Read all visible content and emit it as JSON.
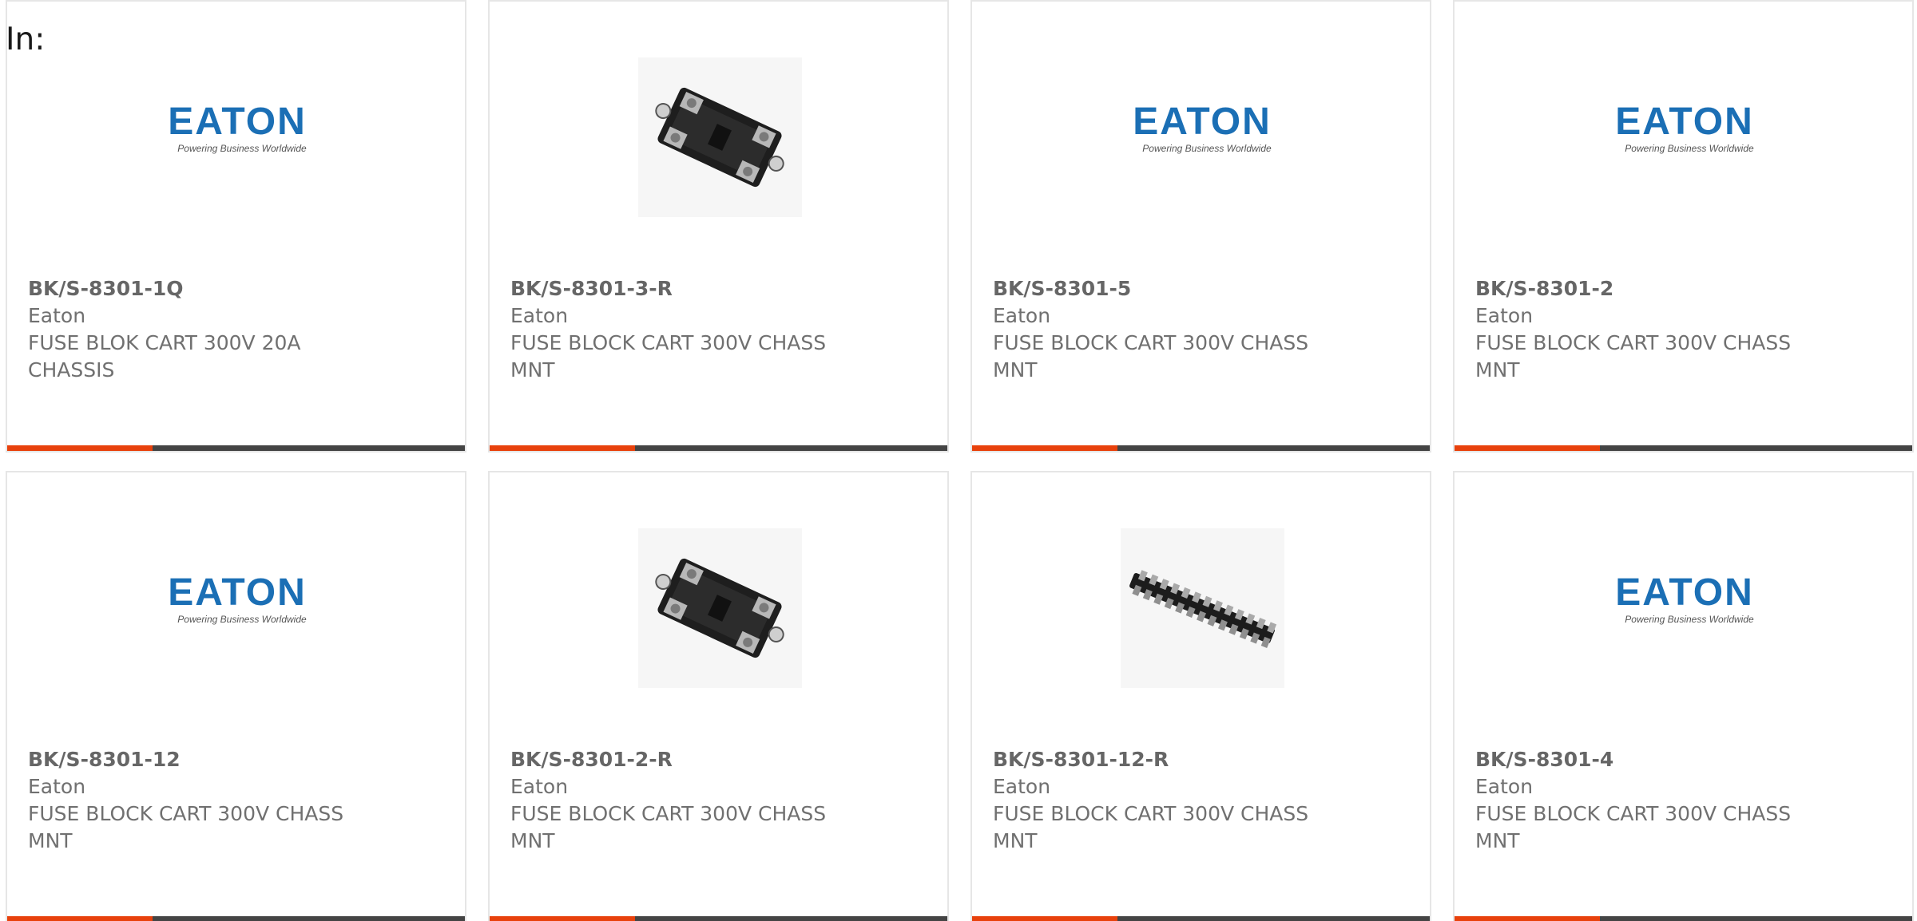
{
  "header": {
    "in_label": "In:"
  },
  "logo": {
    "word": "EATON",
    "tagline": "Powering Business Worldwide",
    "color": "#1b6fb5"
  },
  "accent_color": "#e8410c",
  "products": [
    {
      "part": "BK/S-8301-1Q",
      "manufacturer": "Eaton",
      "description": "FUSE BLOK CART 300V 20A CHASSIS",
      "image": "eaton-logo"
    },
    {
      "part": "BK/S-8301-3-R",
      "manufacturer": "Eaton",
      "description": "FUSE BLOCK CART 300V CHASS MNT",
      "image": "fuse-block-photo"
    },
    {
      "part": "BK/S-8301-5",
      "manufacturer": "Eaton",
      "description": "FUSE BLOCK CART 300V CHASS MNT",
      "image": "eaton-logo"
    },
    {
      "part": "BK/S-8301-2",
      "manufacturer": "Eaton",
      "description": "FUSE BLOCK CART 300V CHASS MNT",
      "image": "eaton-logo"
    },
    {
      "part": "BK/S-8301-12",
      "manufacturer": "Eaton",
      "description": "FUSE BLOCK CART 300V CHASS MNT",
      "image": "eaton-logo"
    },
    {
      "part": "BK/S-8301-2-R",
      "manufacturer": "Eaton",
      "description": "FUSE BLOCK CART 300V CHASS MNT",
      "image": "fuse-block-photo"
    },
    {
      "part": "BK/S-8301-12-R",
      "manufacturer": "Eaton",
      "description": "FUSE BLOCK CART 300V CHASS MNT",
      "image": "fuse-strip-photo"
    },
    {
      "part": "BK/S-8301-4",
      "manufacturer": "Eaton",
      "description": "FUSE BLOCK CART 300V CHASS MNT",
      "image": "eaton-logo"
    }
  ]
}
